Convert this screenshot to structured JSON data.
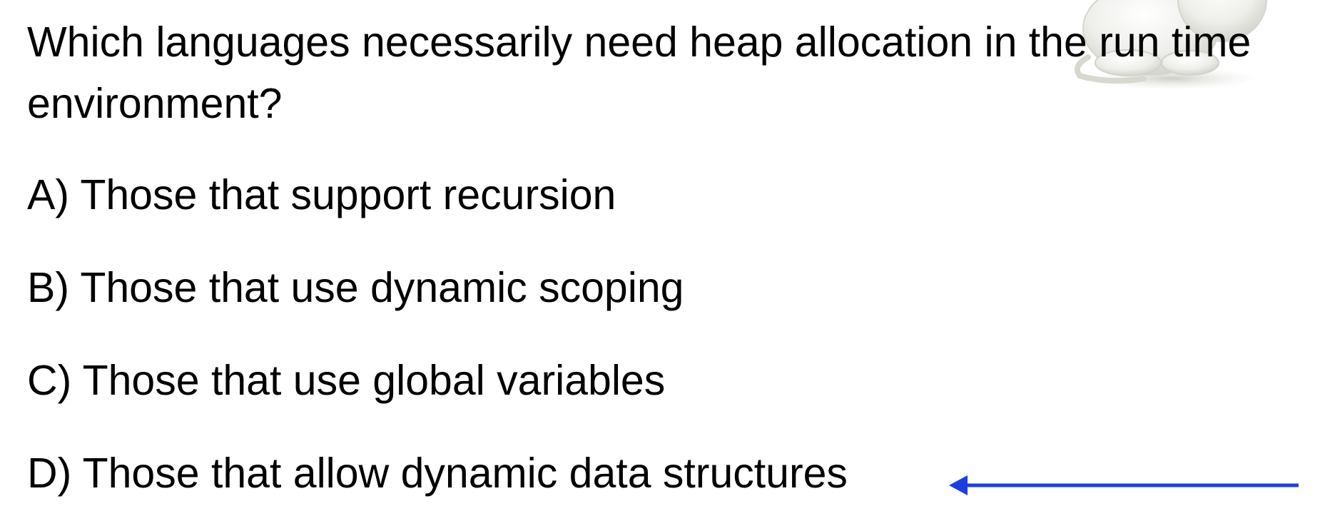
{
  "question": {
    "text": "Which languages necessarily need heap allocation in the run time environment?"
  },
  "options": [
    {
      "label": "A) Those that support recursion"
    },
    {
      "label": "B) Those that use dynamic scoping"
    },
    {
      "label": "C) Those that use global variables"
    },
    {
      "label": "D) Those that allow dynamic data structures"
    }
  ],
  "answer_marker": {
    "icon": "left-arrow-icon",
    "points_to": "D",
    "color": "#1a3fe0"
  },
  "decoration": {
    "icon": "cartoon-mascot-icon"
  }
}
